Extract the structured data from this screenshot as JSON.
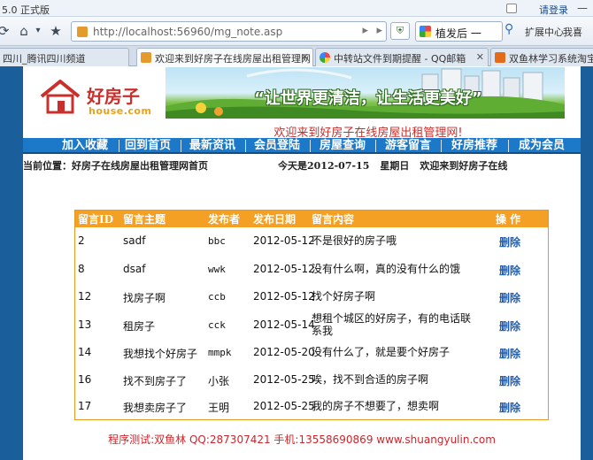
{
  "browser": {
    "title": "5.0 正式版",
    "login": "请登录",
    "url": "http://localhost:56960/mg_note.asp",
    "search_text": "植发后 一",
    "extensions": "扩展中心",
    "extension2": "我喜",
    "tabs": [
      {
        "label": "四川_腾讯四川频道",
        "active": false
      },
      {
        "label": "欢迎来到好房子在线房屋出租管理网！",
        "active": true
      },
      {
        "label": "中转站文件到期提醒 - QQ邮箱",
        "active": false
      },
      {
        "label": "双鱼林学习系统淘宝店",
        "active": false
      }
    ]
  },
  "site": {
    "logo_cn": "好房子",
    "logo_en": "house.com",
    "slogan": "“让世界更清洁，让生活更美好”",
    "welcome": "欢迎来到好房子在线房屋出租管理网!",
    "menu": [
      "加入收藏",
      "回到首页",
      "最新资讯",
      "会员登陆",
      "房屋查询",
      "游客留言",
      "好房推荐",
      "成为会员"
    ],
    "location": "当前位置：好房子在线房屋出租管理网首页",
    "date": "今天是2012-07-15",
    "weekday": "星期日",
    "greeting": "欢迎来到好房子在线"
  },
  "board": {
    "headers": [
      "留言ID",
      "留言主题",
      "发布者",
      "发布日期",
      "留言内容",
      "操 作"
    ],
    "delete_label": "删除",
    "rows": [
      {
        "id": "2",
        "subject": "sadf",
        "author": "bbc",
        "date": "2012-05-12",
        "content": "不是很好的房子哦"
      },
      {
        "id": "8",
        "subject": "dsaf",
        "author": "wwk",
        "date": "2012-05-12",
        "content": "没有什么啊，真的没有什么的饿"
      },
      {
        "id": "12",
        "subject": "找房子啊",
        "author": "ccb",
        "date": "2012-05-12",
        "content": "找个好房子啊"
      },
      {
        "id": "13",
        "subject": "租房子",
        "author": "cck",
        "date": "2012-05-14",
        "content": "想租个城区的好房子，有的电话联系我"
      },
      {
        "id": "14",
        "subject": "我想找个好房子",
        "author": "mmpk",
        "date": "2012-05-20",
        "content": "没有什么了，就是要个好房子"
      },
      {
        "id": "16",
        "subject": "找不到房子了",
        "author": "小张",
        "date": "2012-05-25",
        "content": "唉，找不到合适的房子啊"
      },
      {
        "id": "17",
        "subject": "我想卖房子了",
        "author": "王明",
        "date": "2012-05-25",
        "content": "我的房子不想要了，想卖啊"
      }
    ]
  },
  "footer": "程序测试:双鱼林 QQ:287307421 手机:13558690869 www.shuangyulin.com",
  "colors": {
    "page_bg": "#1a5f9c",
    "menu_bg": "#1c78c8",
    "table_head": "#f3a024",
    "accent_red": "#c9302c",
    "link_blue": "#1f5fb3"
  }
}
